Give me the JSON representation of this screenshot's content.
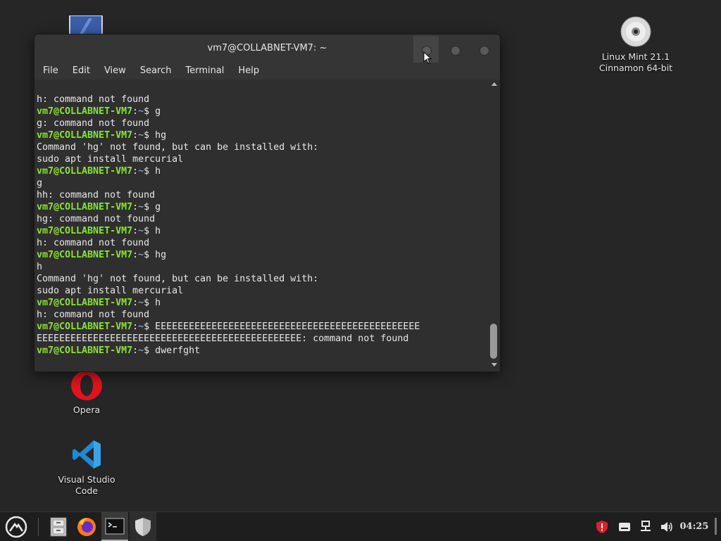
{
  "desktop": {
    "icons": [
      {
        "name": "computer",
        "label": ""
      },
      {
        "name": "disc",
        "label_line1": "Linux Mint 21.1",
        "label_line2": "Cinnamon 64-bit"
      },
      {
        "name": "opera",
        "label": "Opera"
      },
      {
        "name": "vscode",
        "label_line1": "Visual Studio",
        "label_line2": "Code"
      }
    ]
  },
  "window": {
    "title": "vm7@COLLABNET-VM7: ~",
    "menu": [
      "File",
      "Edit",
      "View",
      "Search",
      "Terminal",
      "Help"
    ]
  },
  "terminal": {
    "prompt_user": "vm7@COLLABNET-VM7",
    "prompt_path": "~",
    "lines": [
      {
        "type": "out",
        "text": "h: command not found"
      },
      {
        "type": "cmd",
        "text": "g"
      },
      {
        "type": "out",
        "text": "g: command not found"
      },
      {
        "type": "cmd",
        "text": "hg"
      },
      {
        "type": "out",
        "text": "Command 'hg' not found, but can be installed with:"
      },
      {
        "type": "out",
        "text": "sudo apt install mercurial"
      },
      {
        "type": "cmd",
        "text": "h"
      },
      {
        "type": "out",
        "text": "g"
      },
      {
        "type": "out",
        "text": "hh: command not found"
      },
      {
        "type": "cmd",
        "text": "g"
      },
      {
        "type": "out",
        "text": "hg: command not found"
      },
      {
        "type": "cmd",
        "text": "h"
      },
      {
        "type": "out",
        "text": "h: command not found"
      },
      {
        "type": "cmd",
        "text": "hg"
      },
      {
        "type": "out",
        "text": "h"
      },
      {
        "type": "out",
        "text": "Command 'hg' not found, but can be installed with:"
      },
      {
        "type": "out",
        "text": "sudo apt install mercurial"
      },
      {
        "type": "cmd",
        "text": "h"
      },
      {
        "type": "out",
        "text": "h: command not found"
      },
      {
        "type": "cmd",
        "text": "EEEEEEEEEEEEEEEEEEEEEEEEEEEEEEEEEEEEEEEEEEEEEEE"
      },
      {
        "type": "out",
        "text": "EEEEEEEEEEEEEEEEEEEEEEEEEEEEEEEEEEEEEEEEEEEEEEE: command not found"
      },
      {
        "type": "cmd",
        "text": "dwerfght"
      }
    ]
  },
  "taskbar": {
    "clock": "04:25",
    "items": [
      "menu-icon",
      "files-icon",
      "firefox-icon",
      "terminal-icon",
      "shield-icon"
    ],
    "tray": [
      "security-shield-icon",
      "keyboard-icon",
      "network-icon",
      "volume-icon"
    ]
  },
  "colors": {
    "prompt_user": "#8ae234",
    "prompt_path": "#729fcf",
    "terminal_bg": "#2f2f2f",
    "desktop_bg": "#262626"
  }
}
